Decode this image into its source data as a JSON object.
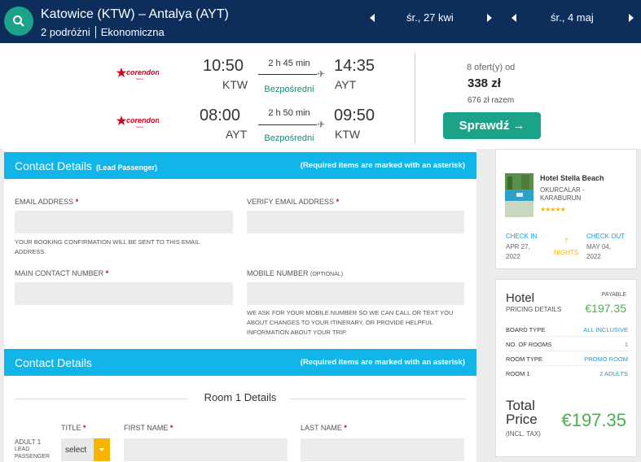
{
  "search": {
    "route": "Katowice (KTW) – Antalya (AYT)",
    "travellers": "2 podróżni",
    "cabin": "Ekonomiczna",
    "depart_date": "śr., 27 kwi",
    "return_date": "śr., 4 maj"
  },
  "flights": {
    "outbound": {
      "airline": "corendon",
      "dep_time": "10:50",
      "dep_code": "KTW",
      "duration": "2 h 45 min",
      "stops": "Bezpośredni",
      "arr_time": "14:35",
      "arr_code": "AYT"
    },
    "inbound": {
      "airline": "corendon",
      "dep_time": "08:00",
      "dep_code": "AYT",
      "duration": "2 h 50 min",
      "stops": "Bezpośredni",
      "arr_time": "09:50",
      "arr_code": "KTW"
    },
    "offers": "8 ofert(y) od",
    "price": "338 zł",
    "total": "676 zł razem",
    "cta": "Sprawdź"
  },
  "contact": {
    "title": "Contact Details",
    "lead": "(Lead Passenger)",
    "required_note": "(Required items are marked with an asterisk)",
    "email_label": "EMAIL ADDRESS",
    "verify_label": "VERIFY EMAIL ADDRESS",
    "email_note_1": "YOUR BOOKING CONFIRMATION WILL BE SENT TO THIS EMAIL",
    "email_note_2": "ADDRESS.",
    "main_number_label": "MAIN CONTACT NUMBER",
    "mobile_label": "MOBILE NUMBER",
    "mobile_optional": "(OPTIONAL)",
    "mobile_note_1": "WE ASK FOR YOUR MOBILE NUMBER SO WE CAN CALL OR TEXT YOU",
    "mobile_note_2": "ABOUT CHANGES TO YOUR ITINERARY, OR PROVIDE HELPFUL",
    "mobile_note_3": "INFORMATION ABOUT YOUR TRIP.",
    "asterisk": "*"
  },
  "passengers": {
    "title": "Contact Details",
    "required_note": "(Required items are marked with an asterisk)",
    "room_title": "Room 1 Details",
    "title_label": "TITLE",
    "first_name_label": "FIRST NAME",
    "last_name_label": "LAST NAME",
    "adult": "ADULT 1",
    "lead_1": "LEAD",
    "lead_2": "PASSENGER",
    "select": "select"
  },
  "hotel": {
    "name": "Hotel Stella Beach",
    "loc_1": "OKURCALAR -",
    "loc_2": "KARABURUN",
    "stars": "★★★★★",
    "checkin_label": "CHECK IN",
    "checkin_1": "APR 27,",
    "checkin_2": "2022",
    "nights_n": "7",
    "nights_label": "NIGHTS",
    "checkout_label": "CHECK OUT",
    "checkout_1": "MAY 04,",
    "checkout_2": "2022"
  },
  "pricing": {
    "heading": "Hotel",
    "sub": "PRICING DETAILS",
    "payable": "PAYABLE",
    "amount": "€197.35",
    "rows": [
      {
        "k": "BOARD TYPE",
        "v": "ALL INCLUSIVE"
      },
      {
        "k": "NO. OF ROOMS",
        "v": "1"
      },
      {
        "k": "ROOM TYPE",
        "v": "PROMO ROOM"
      },
      {
        "k": "ROOM 1",
        "v": "2 ADULTS"
      }
    ],
    "total_1": "Total",
    "total_2": "Price",
    "tax": "(INCL. TAX)",
    "total_amount": "€197.35"
  },
  "colors": {
    "navy": "#0d2d5a",
    "teal": "#1aa389",
    "sky": "#12b5e8",
    "green": "#4caf50",
    "amber": "#f7b500"
  }
}
